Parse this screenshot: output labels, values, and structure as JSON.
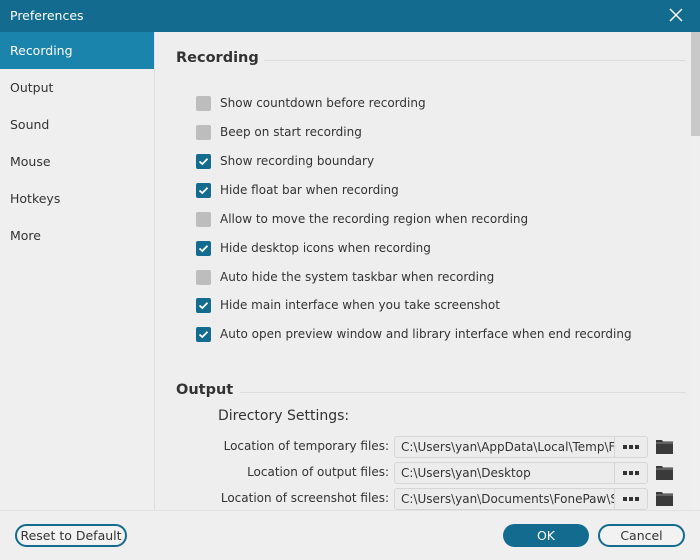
{
  "window": {
    "title": "Preferences",
    "close_icon": "close-x-icon"
  },
  "colors": {
    "accent": "#136b8f",
    "active_nav": "#1b84ad",
    "unchecked": "#bdbdbd"
  },
  "sidebar": {
    "items": [
      {
        "label": "Recording",
        "active": true
      },
      {
        "label": "Output",
        "active": false
      },
      {
        "label": "Sound",
        "active": false
      },
      {
        "label": "Mouse",
        "active": false
      },
      {
        "label": "Hotkeys",
        "active": false
      },
      {
        "label": "More",
        "active": false
      }
    ]
  },
  "recording": {
    "heading": "Recording",
    "options": [
      {
        "label": "Show countdown before recording",
        "checked": false
      },
      {
        "label": "Beep on start recording",
        "checked": false
      },
      {
        "label": "Show recording boundary",
        "checked": true
      },
      {
        "label": "Hide float bar when recording",
        "checked": true
      },
      {
        "label": "Allow to move the recording region when recording",
        "checked": false
      },
      {
        "label": "Hide desktop icons when recording",
        "checked": true
      },
      {
        "label": "Auto hide the system taskbar when recording",
        "checked": false
      },
      {
        "label": "Hide main interface when you take screenshot",
        "checked": true
      },
      {
        "label": "Auto open preview window and library interface when end recording",
        "checked": true
      }
    ]
  },
  "output": {
    "heading": "Output",
    "directory_title": "Directory Settings:",
    "locations": [
      {
        "label": "Location of temporary files:",
        "value": "C:\\Users\\yan\\AppData\\Local\\Temp\\FonePaw"
      },
      {
        "label": "Location of output files:",
        "value": "C:\\Users\\yan\\Desktop"
      },
      {
        "label": "Location of screenshot files:",
        "value": "C:\\Users\\yan\\Documents\\FonePaw\\Snapshot"
      }
    ]
  },
  "footer": {
    "reset_label": "Reset to Default",
    "ok_label": "OK",
    "cancel_label": "Cancel"
  }
}
